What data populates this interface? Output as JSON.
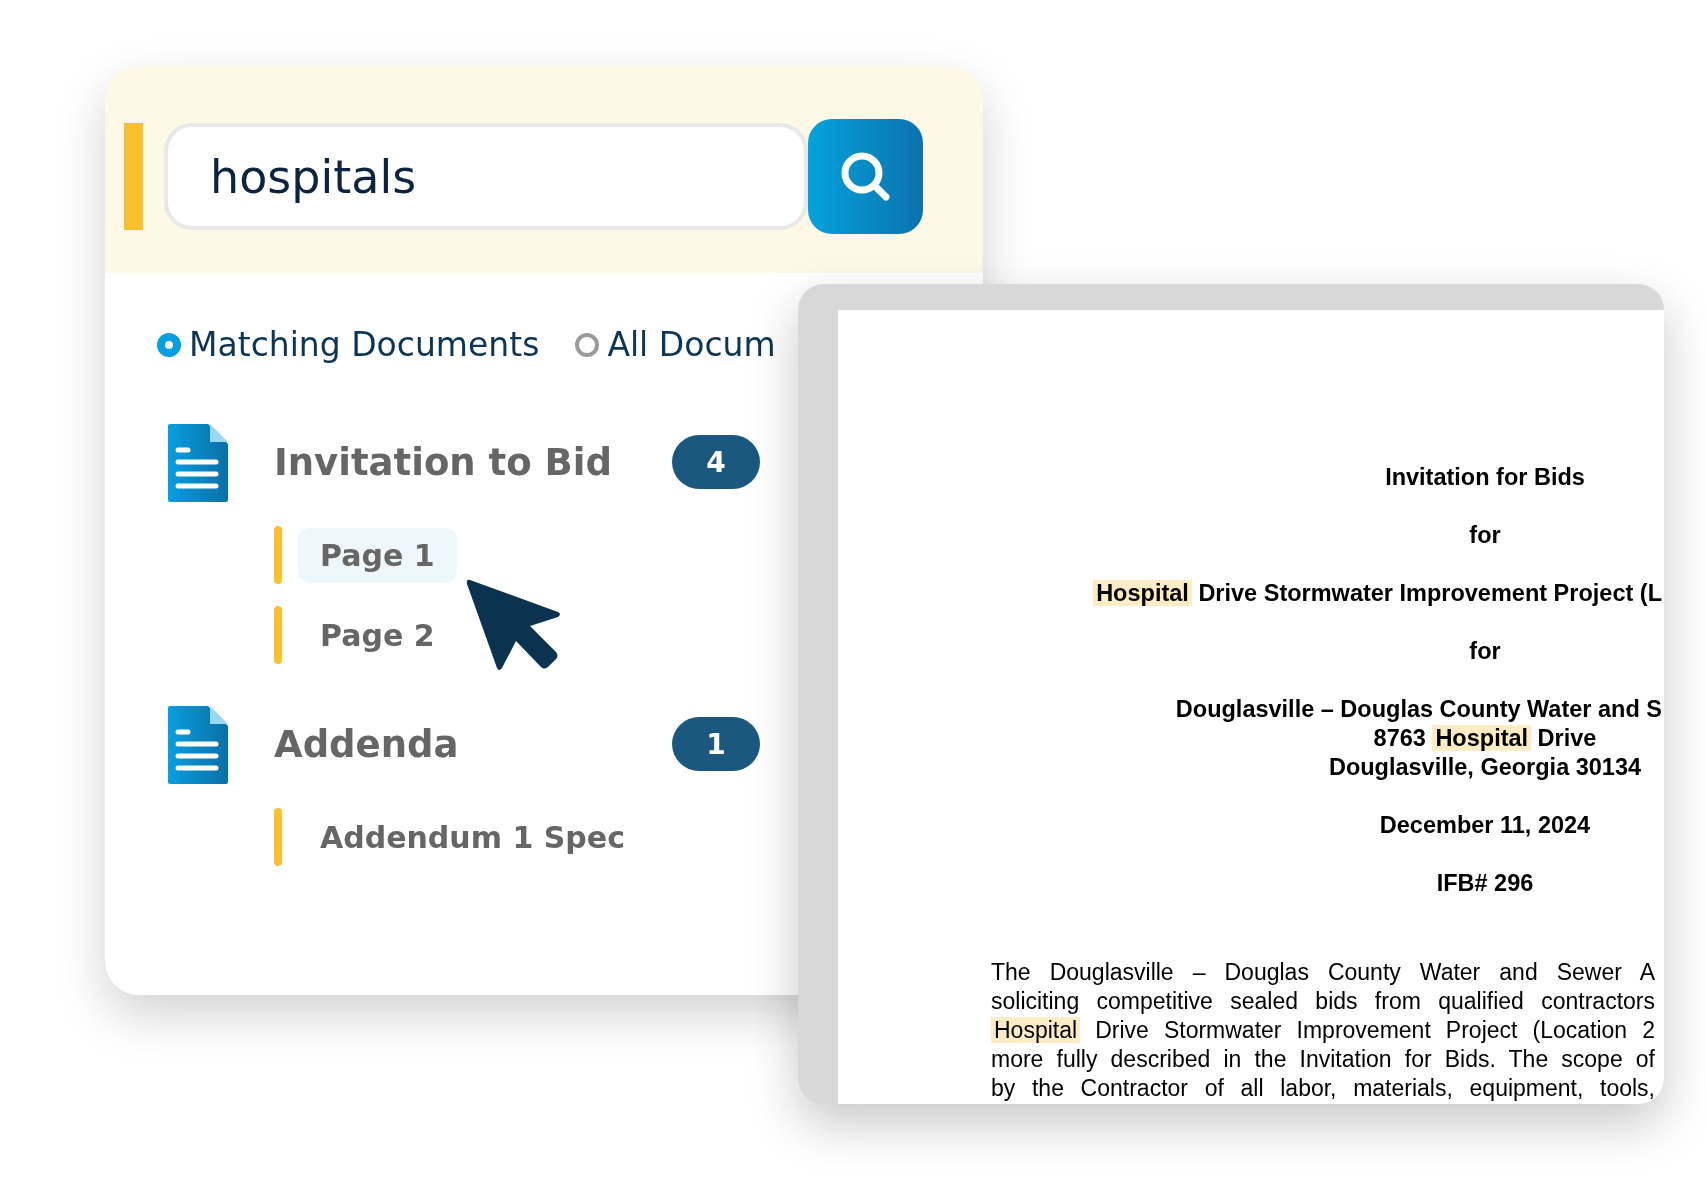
{
  "search": {
    "value": "hospitals"
  },
  "filters": [
    {
      "label": "Matching Documents",
      "selected": true
    },
    {
      "label": "All Docum",
      "selected": false
    }
  ],
  "documents": [
    {
      "title": "Invitation to Bid",
      "count": "4",
      "pages": [
        {
          "label": "Page 1",
          "selected": true
        },
        {
          "label": "Page 2",
          "selected": false
        }
      ]
    },
    {
      "title": "Addenda",
      "count": "1",
      "pages": [
        {
          "label": "Addendum 1 Spec",
          "selected": false
        }
      ]
    }
  ],
  "viewer": {
    "heading_blocks": [
      [
        {
          "kind": "center",
          "segments": [
            {
              "text": "Invitation for Bids",
              "highlighted": false
            }
          ]
        }
      ],
      [
        {
          "kind": "center",
          "segments": [
            {
              "text": "for",
              "highlighted": false
            }
          ]
        }
      ],
      [
        {
          "kind": "edge",
          "segments": [
            {
              "text": "Hospital",
              "highlighted": true
            },
            {
              "text": " Drive Stormwater Improvement Project (L",
              "highlighted": false
            }
          ]
        }
      ],
      [
        {
          "kind": "center",
          "segments": [
            {
              "text": "for",
              "highlighted": false
            }
          ]
        }
      ],
      [
        {
          "kind": "edge",
          "segments": [
            {
              "text": "Douglasville – Douglas County Water and S",
              "highlighted": false
            }
          ]
        },
        {
          "kind": "center",
          "segments": [
            {
              "text": "8763 ",
              "highlighted": false
            },
            {
              "text": "Hospital",
              "highlighted": true
            },
            {
              "text": " Drive",
              "highlighted": false
            }
          ]
        },
        {
          "kind": "center",
          "segments": [
            {
              "text": "Douglasville, Georgia 30134",
              "highlighted": false
            }
          ]
        }
      ],
      [
        {
          "kind": "center",
          "segments": [
            {
              "text": "December 11, 2024",
              "highlighted": false
            }
          ]
        }
      ],
      [
        {
          "kind": "center",
          "segments": [
            {
              "text": "IFB# 296",
              "highlighted": false
            }
          ]
        }
      ]
    ],
    "body_lines": [
      [
        {
          "text": "The Douglasville – Douglas County Water and Sewer A",
          "highlighted": false
        }
      ],
      [
        {
          "text": "soliciting competitive sealed bids from qualified contractors",
          "highlighted": false
        }
      ],
      [
        {
          "text": "Hospital",
          "highlighted": true
        },
        {
          "text": " Drive Stormwater Improvement Project (Location 2",
          "highlighted": false
        }
      ],
      [
        {
          "text": "more fully described in the Invitation for Bids.  The scope of",
          "highlighted": false
        }
      ],
      [
        {
          "text": "by the Contractor of all labor, materials, equipment, tools,",
          "highlighted": false
        }
      ]
    ]
  }
}
